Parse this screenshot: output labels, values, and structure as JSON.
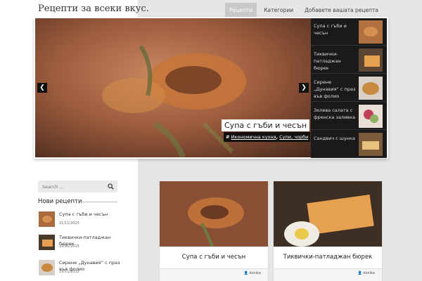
{
  "site": {
    "title": "Рецепти за всеки вкус."
  },
  "nav": {
    "items": [
      {
        "label": "Рецепти",
        "active": true
      },
      {
        "label": "Категории",
        "active": false
      },
      {
        "label": "Добавете вашата рецепта",
        "active": false
      }
    ]
  },
  "slider": {
    "caption_title": "Супа с гъби и чесън",
    "tag_prefix": "#",
    "tag_1": "Икономична кухня",
    "tag_sep": ",",
    "tag_2": "Супи, чорби",
    "prev_icon": "chevron-left-icon",
    "next_icon": "chevron-right-icon",
    "thumbs": [
      {
        "label": "Супа с гъби и чесън"
      },
      {
        "label": "Тиквички-патладжан бюрек"
      },
      {
        "label": "Сирене „Дунавия“ с праз във фолио"
      },
      {
        "label": "Зелева салата с френска заливка"
      },
      {
        "label": "Сандвич с шунка"
      }
    ]
  },
  "sidebar": {
    "search_placeholder": "Search ...",
    "widget_title": "Нови рецепти",
    "items": [
      {
        "title": "Супа с гъби и чесън",
        "date": "21/11/2015"
      },
      {
        "title": "Тиквички-патладжан бюрек",
        "date": "19/11/2015"
      },
      {
        "title": "Сирене „Дунавия“ с праз във фолио",
        "date": "19/11/2015"
      }
    ]
  },
  "cards": [
    {
      "title": "Супа с гъби и чесън",
      "author": "donika"
    },
    {
      "title": "Тиквички-патладжан бюрек",
      "author": "donika"
    }
  ],
  "colors": {
    "accent_active_nav": "#c9c9c9",
    "thumb_bar": "#1a1a1a",
    "page_bg": "#e6e6e6"
  }
}
